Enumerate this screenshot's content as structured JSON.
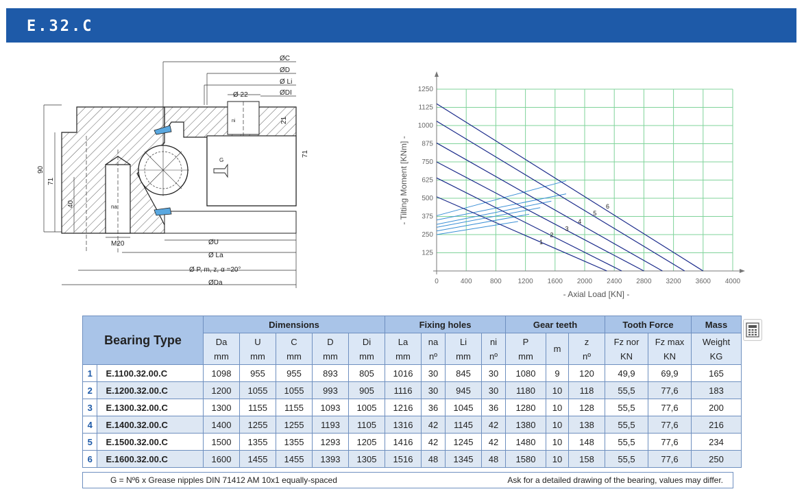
{
  "title": "E.32.C",
  "drawing": {
    "labels": {
      "C": "ØC",
      "D": "ØD",
      "Li": "Ø Li",
      "Di": "ØDI",
      "hole": "Ø 22",
      "ni": "ni",
      "h21": "21",
      "h71r": "71",
      "G": "G",
      "h90": "90",
      "h71l": "71",
      "h40": "40",
      "na": "na",
      "M20": "M20",
      "U": "ØU",
      "La": "Ø La",
      "P": "Ø P, m, z, α =20°",
      "Da": "ØDa"
    }
  },
  "chart_data": {
    "type": "line",
    "title": "",
    "xlabel": "-  Axial Load  [KN]  -",
    "ylabel": "-  Tilting Moment  [KNm]  -",
    "xlim": [
      0,
      4000
    ],
    "ylim": [
      0,
      1250
    ],
    "x_ticks": [
      "0",
      "400",
      "800",
      "1200",
      "1600",
      "2000",
      "2400",
      "2800",
      "3200",
      "3600",
      "4000"
    ],
    "y_ticks": [
      "125",
      "250",
      "375",
      "500",
      "625",
      "750",
      "875",
      "1000",
      "1125",
      "1250"
    ],
    "grid": true,
    "series": [
      {
        "name": "1",
        "points": [
          [
            0,
            510
          ],
          [
            2300,
            0
          ]
        ]
      },
      {
        "name": "2",
        "points": [
          [
            0,
            640
          ],
          [
            2500,
            0
          ]
        ]
      },
      {
        "name": "3",
        "points": [
          [
            0,
            750
          ],
          [
            2800,
            0
          ]
        ]
      },
      {
        "name": "4",
        "points": [
          [
            0,
            880
          ],
          [
            3050,
            0
          ]
        ]
      },
      {
        "name": "5",
        "points": [
          [
            0,
            1030
          ],
          [
            3350,
            0
          ]
        ]
      },
      {
        "name": "6",
        "points": [
          [
            0,
            1150
          ],
          [
            3600,
            0
          ]
        ]
      }
    ],
    "secondary_lines": [
      {
        "points": [
          [
            0,
            250
          ],
          [
            1100,
            340
          ]
        ]
      },
      {
        "points": [
          [
            0,
            275
          ],
          [
            1250,
            390
          ]
        ]
      },
      {
        "points": [
          [
            0,
            300
          ],
          [
            1400,
            435
          ]
        ]
      },
      {
        "points": [
          [
            0,
            320
          ],
          [
            1550,
            480
          ]
        ]
      },
      {
        "points": [
          [
            0,
            350
          ],
          [
            1750,
            530
          ]
        ]
      },
      {
        "points": [
          [
            0,
            380
          ],
          [
            1750,
            620
          ]
        ]
      }
    ]
  },
  "table": {
    "bearing_type_label": "Bearing Type",
    "groups": {
      "dimensions": "Dimensions",
      "fixing": "Fixing holes",
      "gear": "Gear teeth",
      "force": "Tooth Force",
      "mass": "Mass"
    },
    "sub": {
      "Da": [
        "Da",
        "mm"
      ],
      "U": [
        "U",
        "mm"
      ],
      "C": [
        "C",
        "mm"
      ],
      "D": [
        "D",
        "mm"
      ],
      "Di": [
        "Di",
        "mm"
      ],
      "La": [
        "La",
        "mm"
      ],
      "na": [
        "na",
        "nº"
      ],
      "Li": [
        "Li",
        "mm"
      ],
      "ni": [
        "ni",
        "nº"
      ],
      "P": [
        "P",
        "mm"
      ],
      "m": [
        "m",
        ""
      ],
      "z": [
        "z",
        "nº"
      ],
      "Fznor": [
        "Fz nor",
        "KN"
      ],
      "Fzmax": [
        "Fz max",
        "KN"
      ],
      "W": [
        "Weight",
        "KG"
      ]
    },
    "rows": [
      [
        "1",
        "E.1100.32.00.C",
        "1098",
        "955",
        "955",
        "893",
        "805",
        "1016",
        "30",
        "845",
        "30",
        "1080",
        "9",
        "120",
        "49,9",
        "69,9",
        "165"
      ],
      [
        "2",
        "E.1200.32.00.C",
        "1200",
        "1055",
        "1055",
        "993",
        "905",
        "1116",
        "30",
        "945",
        "30",
        "1180",
        "10",
        "118",
        "55,5",
        "77,6",
        "183"
      ],
      [
        "3",
        "E.1300.32.00.C",
        "1300",
        "1155",
        "1155",
        "1093",
        "1005",
        "1216",
        "36",
        "1045",
        "36",
        "1280",
        "10",
        "128",
        "55,5",
        "77,6",
        "200"
      ],
      [
        "4",
        "E.1400.32.00.C",
        "1400",
        "1255",
        "1255",
        "1193",
        "1105",
        "1316",
        "42",
        "1145",
        "42",
        "1380",
        "10",
        "138",
        "55,5",
        "77,6",
        "216"
      ],
      [
        "5",
        "E.1500.32.00.C",
        "1500",
        "1355",
        "1355",
        "1293",
        "1205",
        "1416",
        "42",
        "1245",
        "42",
        "1480",
        "10",
        "148",
        "55,5",
        "77,6",
        "234"
      ],
      [
        "6",
        "E.1600.32.00.C",
        "1600",
        "1455",
        "1455",
        "1393",
        "1305",
        "1516",
        "48",
        "1345",
        "48",
        "1580",
        "10",
        "158",
        "55,5",
        "77,6",
        "250"
      ]
    ],
    "footnote_left": "G = Nº6 x Grease nipples DIN 71412 AM 10x1 equally-spaced",
    "footnote_right": "Ask for a detailed drawing of the bearing, values may differ."
  },
  "calculator_icon": "calculator-icon",
  "colors": {
    "title_bar": "#1e5aa8",
    "grid": "#7fd39a",
    "curve": "#1a2a8a",
    "secondary": "#3a8fd6",
    "header": "#a9c4e8",
    "alt_row": "#dde7f3"
  }
}
